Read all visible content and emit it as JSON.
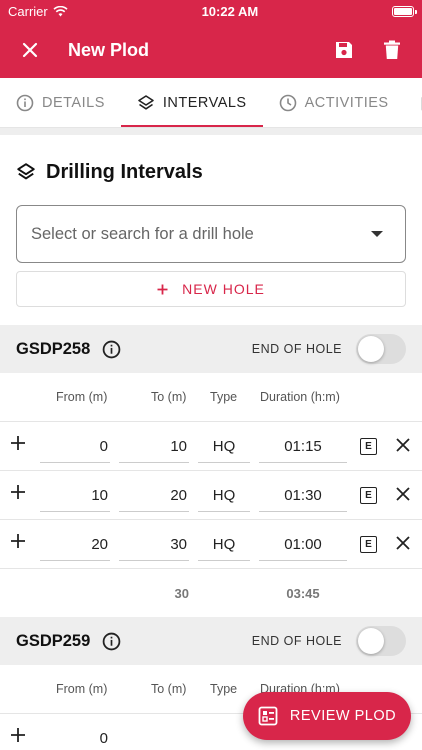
{
  "status": {
    "carrier": "Carrier",
    "time": "10:22 AM"
  },
  "appbar": {
    "title": "New Plod"
  },
  "tabs": [
    {
      "label": "DETAILS",
      "icon": "info-icon"
    },
    {
      "label": "INTERVALS",
      "icon": "layers-icon",
      "active": true
    },
    {
      "label": "ACTIVITIES",
      "icon": "clock-icon"
    },
    {
      "label": "",
      "icon": "clipboard-x-icon"
    }
  ],
  "section": {
    "title": "Drilling Intervals"
  },
  "select": {
    "placeholder": "Select or search for a drill hole"
  },
  "new_hole": {
    "label": "NEW HOLE"
  },
  "columns": {
    "from": "From (m)",
    "to": "To (m)",
    "type": "Type",
    "duration": "Duration (h:m)"
  },
  "holes": [
    {
      "name": "GSDP258",
      "end_of_hole_label": "END OF HOLE",
      "end_of_hole": false,
      "rows": [
        {
          "from": "0",
          "to": "10",
          "type": "HQ",
          "duration": "01:15"
        },
        {
          "from": "10",
          "to": "20",
          "type": "HQ",
          "duration": "01:30"
        },
        {
          "from": "20",
          "to": "30",
          "type": "HQ",
          "duration": "01:00"
        }
      ],
      "total_to": "30",
      "total_duration": "03:45"
    },
    {
      "name": "GSDP259",
      "end_of_hole_label": "END OF HOLE",
      "end_of_hole": false,
      "rows": [
        {
          "from": "0",
          "to": "",
          "type": "",
          "duration": ""
        }
      ]
    }
  ],
  "fab": {
    "label": "REVIEW PLOD"
  },
  "colors": {
    "brand": "#d8264a",
    "grey_bg": "#eeeeee"
  }
}
